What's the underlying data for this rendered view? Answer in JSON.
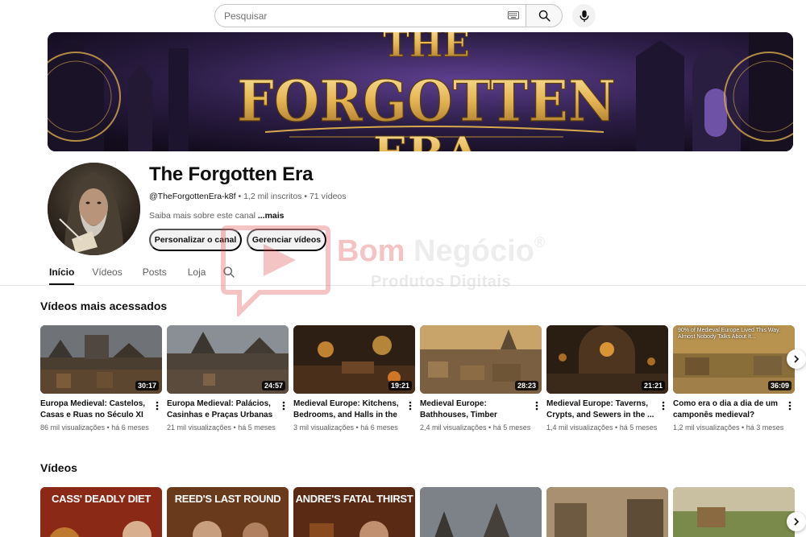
{
  "search": {
    "placeholder": "Pesquisar"
  },
  "channel": {
    "banner_text_line1": "THE",
    "banner_text_line2": "FORGOTTEN",
    "banner_text_line3": "ERA",
    "name": "The Forgotten Era",
    "handle": "@TheForgottenEra-k8f",
    "subscribers": "1,2 mil inscritos",
    "videos_count": "71 vídeos",
    "separator": "•",
    "description": "Saiba mais sobre este canal",
    "more_link": "...mais",
    "customize_button": "Personalizar o canal",
    "manage_button": "Gerenciar vídeos"
  },
  "tabs": [
    "Início",
    "Vídeos",
    "Posts",
    "Loja"
  ],
  "popular": {
    "title": "Vídeos mais acessados",
    "videos": [
      {
        "title": "Europa Medieval: Castelos, Casas e Ruas no Século XI",
        "views": "86 mil visualizações",
        "age": "há 6 meses",
        "duration": "30:17"
      },
      {
        "title": "Europa Medieval: Palácios, Casinhas e Praças Urbanas ...",
        "views": "21 mil visualizações",
        "age": "há 5 meses",
        "duration": "24:57"
      },
      {
        "title": "Medieval Europe: Kitchens, Bedrooms, and Halls in the ...",
        "views": "3 mil visualizações",
        "age": "há 6 meses",
        "duration": "19:21"
      },
      {
        "title": "Medieval Europe: Bathhouses, Timber Homes...",
        "views": "2,4 mil visualizações",
        "age": "há 5 meses",
        "duration": "28:23"
      },
      {
        "title": "Medieval Europe: Taverns, Crypts, and Sewers in the ...",
        "views": "1,4 mil visualizações",
        "age": "há 5 meses",
        "duration": "21:21"
      },
      {
        "title": "Como era o dia a dia de um camponês medieval? (sécul...",
        "views": "1,2 mil visualizações",
        "age": "há 3 meses",
        "duration": "36:09",
        "caption": "90% of Medieval Europe Lived This Way. Almost Nobody Talks About It..."
      }
    ]
  },
  "videos_section": {
    "title": "Vídeos",
    "thumbs": [
      {
        "banner": "CASS' DEADLY DIET"
      },
      {
        "banner": "REED'S LAST ROUND"
      },
      {
        "banner": "ANDRE'S FATAL THIRST"
      },
      {
        "banner": ""
      },
      {
        "banner": ""
      },
      {
        "banner": ""
      }
    ]
  },
  "watermark": {
    "brand_part1": "Bom",
    "brand_part2": "Negócio",
    "registered": "®",
    "subtitle": "Produtos Digitais"
  },
  "colors": {
    "accent": "#0f0f0f",
    "secondary_text": "#606060",
    "pill_bg": "#f2f2f2",
    "banner_gold": "#e8c062"
  }
}
